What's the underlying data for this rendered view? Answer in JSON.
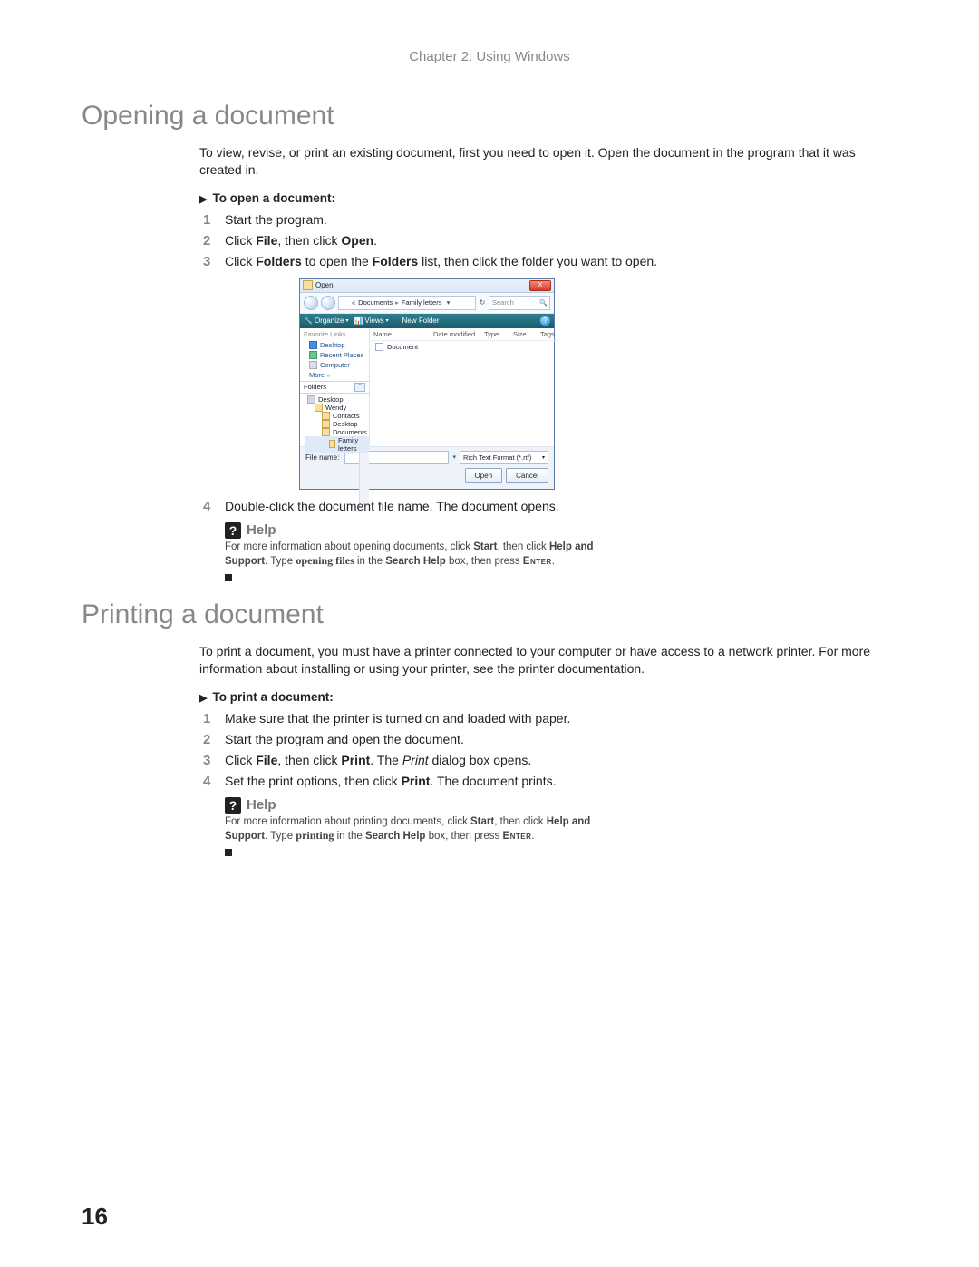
{
  "header": {
    "chapter": "Chapter 2: Using Windows"
  },
  "page_number": "16",
  "s1": {
    "title": "Opening a document",
    "intro": "To view, revise, or print an existing document, first you need to open it. Open the document in the program that it was created in.",
    "proc_title": "To open a document:",
    "step1": "Start the program.",
    "step2_a": "Click ",
    "step2_b": "File",
    "step2_c": ", then click ",
    "step2_d": "Open",
    "step2_e": ".",
    "step3_a": "Click ",
    "step3_b": "Folders",
    "step3_c": " to open the ",
    "step3_d": "Folders",
    "step3_e": " list, then click the folder you want to open.",
    "step4": "Double-click the document file name. The document opens.",
    "help": {
      "label": "Help",
      "l1a": "For more information about opening documents, click ",
      "l1b": "Start",
      "l1c": ", then click ",
      "l1d": "Help and Support",
      "l1e": ". Type ",
      "kw": "opening files",
      "l1f": " in the ",
      "l1g": "Search Help",
      "l1h": " box, then press ",
      "l1i": "Enter",
      "l1j": "."
    }
  },
  "s2": {
    "title": "Printing a document",
    "intro": "To print a document, you must have a printer connected to your computer or have access to a network printer. For more information about installing or using your printer, see the printer documentation.",
    "proc_title": "To print a document:",
    "step1": "Make sure that the printer is turned on and loaded with paper.",
    "step2": "Start the program and open the document.",
    "step3_a": "Click ",
    "step3_b": "File",
    "step3_c": ", then click ",
    "step3_d": "Print",
    "step3_e": ". The ",
    "step3_f": "Print",
    "step3_g": " dialog box opens.",
    "step4_a": "Set the print options, then click ",
    "step4_b": "Print",
    "step4_c": ". The document prints.",
    "help": {
      "label": "Help",
      "l1a": "For more information about printing documents, click ",
      "l1b": "Start",
      "l1c": ", then click ",
      "l1d": "Help and Support",
      "l1e": ". Type ",
      "kw": "printing",
      "l1f": " in the ",
      "l1g": "Search Help",
      "l1h": " box, then press ",
      "l1i": "Enter",
      "l1j": "."
    }
  },
  "dlg": {
    "title": "Open",
    "close": "X",
    "bc1": "«",
    "bc2": "Documents",
    "bc3": "Family letters",
    "refresh_glyph": "↻",
    "search_ph": "Search",
    "tb_org": "Organize",
    "tb_views": "Views",
    "tb_new": "New Folder",
    "fav_hdr": "Favorite Links",
    "fav_desktop": "Desktop",
    "fav_recent": "Recent Places",
    "fav_computer": "Computer",
    "more": "More",
    "more_glyph": "»",
    "folders_hdr": "Folders",
    "folders_glyph": "ˇ",
    "tree_desktop": "Desktop",
    "tree_wendy": "Wendy",
    "tree_contacts": "Contacts",
    "tree_desktop2": "Desktop",
    "tree_documents": "Documents",
    "tree_family": "Family letters",
    "col_name": "Name",
    "col_date": "Date modified",
    "col_type": "Type",
    "col_size": "Size",
    "col_tags": "Tags",
    "fitem": "Document",
    "fn_label": "File name:",
    "filetype": "Rich Text Format (*.rtf)",
    "open": "Open",
    "cancel": "Cancel"
  }
}
